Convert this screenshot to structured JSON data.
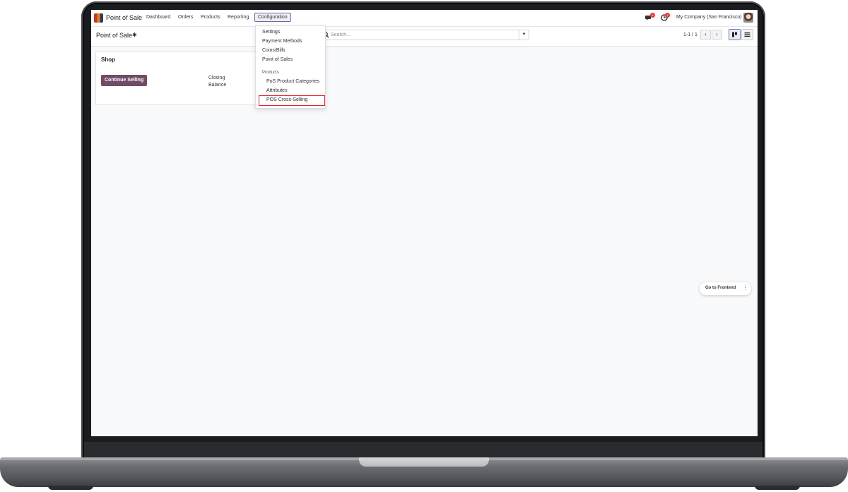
{
  "navbar": {
    "app_name": "Point of Sale",
    "menu": [
      "Dashboard",
      "Orders",
      "Products",
      "Reporting",
      "Configuration"
    ],
    "messages_badge": "3",
    "activity_badge": "1",
    "company": "My Company (San Francisco)"
  },
  "control": {
    "title": "Point of Sale",
    "search_placeholder": "Search...",
    "pager": "1-1 / 1"
  },
  "card": {
    "title": "Shop",
    "continue_label": "Continue Selling",
    "closing_label": "Closing Balance"
  },
  "dropdown": {
    "items": [
      "Settings",
      "Payment Methods",
      "Coins/Bills",
      "Point of Sales"
    ],
    "section_header": "Products",
    "section_items": [
      "PoS Product Categories",
      "Attributes",
      "POS Cross-Selling"
    ]
  },
  "frontend": {
    "label": "Go to Frontend"
  },
  "colors": {
    "brand": "#714b67",
    "highlight": "#e02424",
    "badge": "#e53935"
  }
}
